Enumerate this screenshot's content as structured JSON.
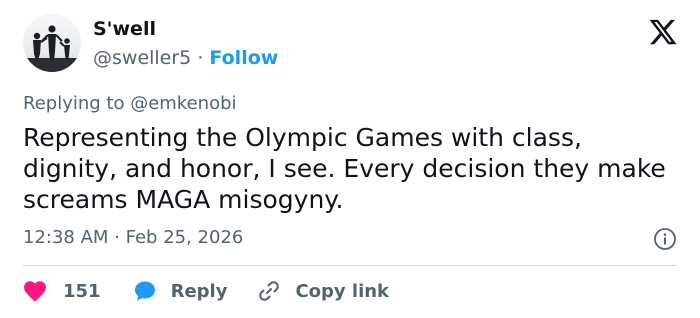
{
  "author": {
    "display_name": "S'well",
    "handle": "@sweller5",
    "separator": "·",
    "follow_label": "Follow"
  },
  "replying_to": "Replying to @emkenobi",
  "tweet": {
    "text": "Representing the Olympic Games with class, dignity, and honor, I see. Every decision they make screams MAGA misogyny."
  },
  "meta": {
    "timestamp": "12:38 AM · Feb 25, 2026"
  },
  "actions": {
    "like_count": "151",
    "reply_label": "Reply",
    "copy_link_label": "Copy link"
  },
  "icons": {
    "brand": "x-logo-icon",
    "info": "info-icon",
    "like": "heart-icon",
    "reply": "speech-bubble-icon",
    "copy": "link-icon"
  },
  "colors": {
    "text_primary": "#0f1419",
    "text_secondary": "#536471",
    "accent": "#1d9bf0",
    "like": "#f91880",
    "divider": "#cfd9de"
  }
}
